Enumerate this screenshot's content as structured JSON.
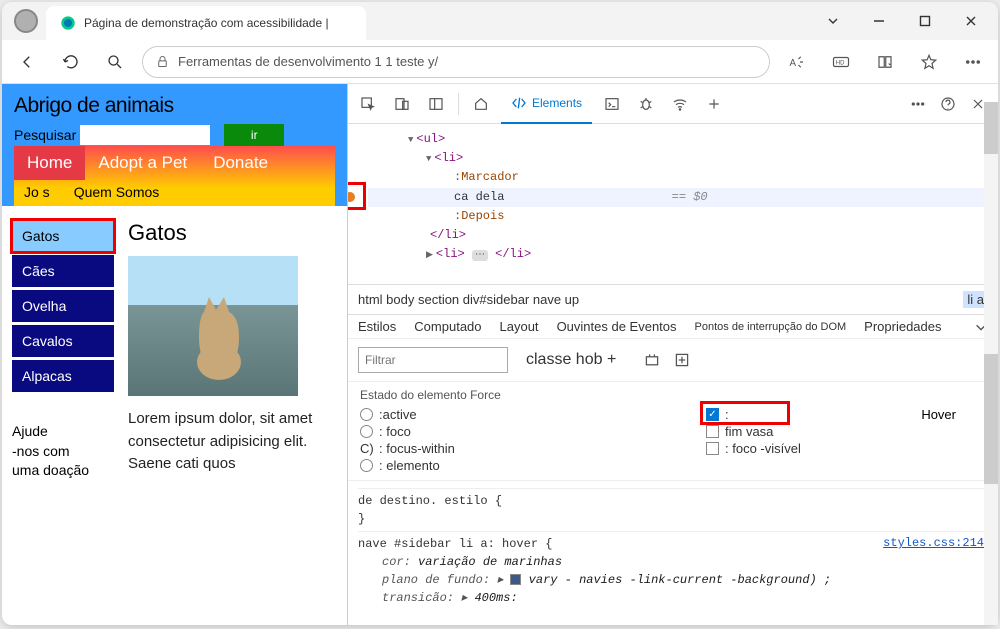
{
  "browser": {
    "tab_title": "Página de demonstração com acessibilidade |",
    "address": "Ferramentas de desenvolvimento 1 1 teste y/"
  },
  "page": {
    "title": "Abrigo de animais",
    "search_label": "Pesquisar",
    "go_label": "ir",
    "nav": {
      "home": "Home",
      "adopt": "Adopt a Pet",
      "donate": "Donate",
      "jos": "Jo s",
      "quem": "Quem Somos"
    },
    "sidebar": [
      "Gatos",
      "Cães",
      "Ovelha",
      "Cavalos",
      "Alpacas"
    ],
    "help": "Ajude\n-nos com\numa doação",
    "heading": "Gatos",
    "lorem": "Lorem ipsum dolor, sit amet consectetur adipisicing elit. Saene cati quos"
  },
  "devtools": {
    "tabs": {
      "elements": "Elements"
    },
    "dom": {
      "ul": "<ul>",
      "li": "<li>",
      "marker": ":Marcador",
      "text": " ca dela",
      "eq": "== $0",
      "after": ":Depois",
      "li_close": "</li>",
      "li2a": "<li>",
      "li2b": "</li>"
    },
    "breadcrumb": {
      "path": "html body section div#sidebar nave up",
      "last": "li a"
    },
    "styles_tabs": {
      "estilos": "Estilos",
      "computado": "Computado",
      "layout": "Layout",
      "eventos": "Ouvintes de Eventos",
      "dom_bp": "Pontos de interrupção do DOM",
      "props": "Propriedades"
    },
    "filter": {
      "placeholder": "Filtrar",
      "cls": "classe hob +"
    },
    "force_state": {
      "title": "Estado do elemento Force",
      "active": ":active",
      "foco": ": foco",
      "focus_within": ": focus-within",
      "elemento": ": elemento",
      "hover_lbl": "Hover",
      "colon": ":",
      "fim_vasa": "fim vasa",
      "foco_visivel": ": foco -visível"
    },
    "css": {
      "rule1_sel": "de destino. estilo {",
      "rule1_close": "}",
      "rule2_sel": "nave #sidebar      li a: hover {",
      "rule2_src": "styles.css:214",
      "rule2_p1k": "cor:",
      "rule2_p1v": "variação de marinhas",
      "rule2_p2k": "plano de fundo:",
      "rule2_p2v": "vary - navies -link-current -background) ;",
      "rule2_p3k": "transicão:",
      "rule2_p3v": "400ms:"
    }
  }
}
